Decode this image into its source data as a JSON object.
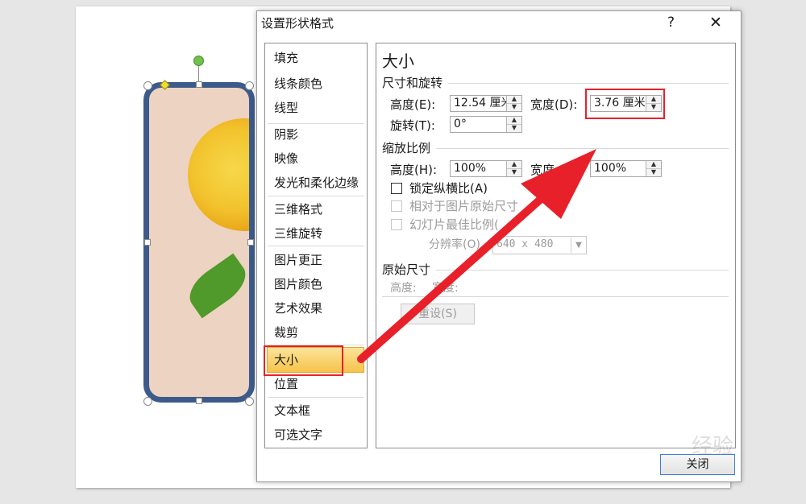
{
  "dialog": {
    "title": "设置形状格式",
    "help_label": "?",
    "close_glyph": "✕",
    "close_button_label": "关闭"
  },
  "nav": {
    "items": [
      "填充",
      "线条颜色",
      "线型",
      "阴影",
      "映像",
      "发光和柔化边缘",
      "三维格式",
      "三维旋转",
      "图片更正",
      "图片颜色",
      "艺术效果",
      "裁剪",
      "大小",
      "位置",
      "文本框",
      "可选文字"
    ],
    "selected": "大小"
  },
  "panel": {
    "heading": "大小",
    "size_rotate": {
      "title": "尺寸和旋转",
      "height_label": "高度(E):",
      "height_value": "12.54 厘米",
      "width_label": "宽度(D):",
      "width_value": "3.76 厘米",
      "rotation_label": "旋转(T):",
      "rotation_value": "0°"
    },
    "scale": {
      "title": "缩放比例",
      "height_label": "高度(H):",
      "height_value": "100%",
      "width_label": "宽度",
      "width_value": "100%",
      "lock_aspect_label": "锁定纵横比(A)",
      "relative_label": "相对于图片原始尺寸",
      "best_scale_label": "幻灯片最佳比例(",
      "resolution_label": "分辨率(O)",
      "resolution_value": "640 x 480"
    },
    "original": {
      "title": "原始尺寸",
      "height_label": "高度:",
      "width_label": "宽度:",
      "reset_label": "重设(S)"
    }
  },
  "watermark": "经验",
  "colors": {
    "accent_red": "#e8202a",
    "shape_border": "#3c5a8a",
    "selected_bg": "#f8d070"
  }
}
